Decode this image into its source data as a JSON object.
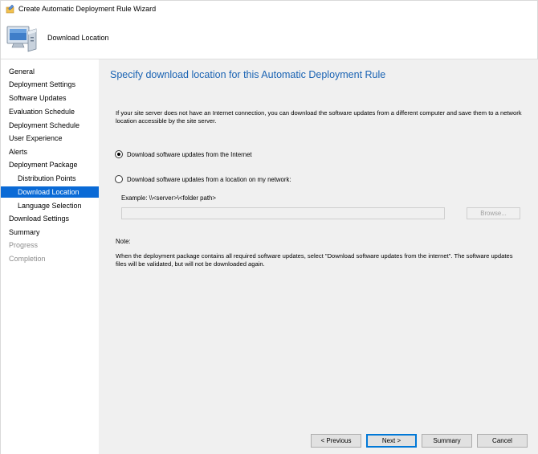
{
  "window": {
    "title": "Create Automatic Deployment Rule Wizard"
  },
  "header": {
    "page_name": "Download Location"
  },
  "sidebar": {
    "items": [
      {
        "label": "General",
        "state": "normal",
        "level": 0
      },
      {
        "label": "Deployment Settings",
        "state": "normal",
        "level": 0
      },
      {
        "label": "Software Updates",
        "state": "normal",
        "level": 0
      },
      {
        "label": "Evaluation Schedule",
        "state": "normal",
        "level": 0
      },
      {
        "label": "Deployment Schedule",
        "state": "normal",
        "level": 0
      },
      {
        "label": "User Experience",
        "state": "normal",
        "level": 0
      },
      {
        "label": "Alerts",
        "state": "normal",
        "level": 0
      },
      {
        "label": "Deployment Package",
        "state": "normal",
        "level": 0
      },
      {
        "label": "Distribution Points",
        "state": "normal",
        "level": 1
      },
      {
        "label": "Download Location",
        "state": "active",
        "level": 1
      },
      {
        "label": "Language Selection",
        "state": "normal",
        "level": 1
      },
      {
        "label": "Download Settings",
        "state": "normal",
        "level": 0
      },
      {
        "label": "Summary",
        "state": "normal",
        "level": 0
      },
      {
        "label": "Progress",
        "state": "disabled",
        "level": 0
      },
      {
        "label": "Completion",
        "state": "disabled",
        "level": 0
      }
    ]
  },
  "main": {
    "heading": "Specify download location for this Automatic Deployment Rule",
    "intro": "If your site server does not have an Internet connection, you can download the software updates from a different computer and save them to a network location accessible by the site server.",
    "option_internet": {
      "label": "Download software updates from the Internet",
      "checked": true
    },
    "option_network": {
      "label": "Download software updates from a location on my network:",
      "checked": false
    },
    "example": "Example: \\\\<server>\\<folder path>",
    "path_value": "",
    "browse_label": "Browse...",
    "note_label": "Note:",
    "note_text": "When the deployment package contains all required software updates, select \"Download  software updates from the internet\". The software updates files will be validated, but will not be downloaded again."
  },
  "footer": {
    "previous_label": "< Previous",
    "next_label": "Next >",
    "summary_label": "Summary",
    "cancel_label": "Cancel"
  },
  "colors": {
    "accent": "#0a6ad6",
    "heading": "#1a63b3",
    "panel": "#f0f0f0"
  },
  "icons": {
    "app": "wizard-app-icon",
    "header": "computer-icon"
  }
}
